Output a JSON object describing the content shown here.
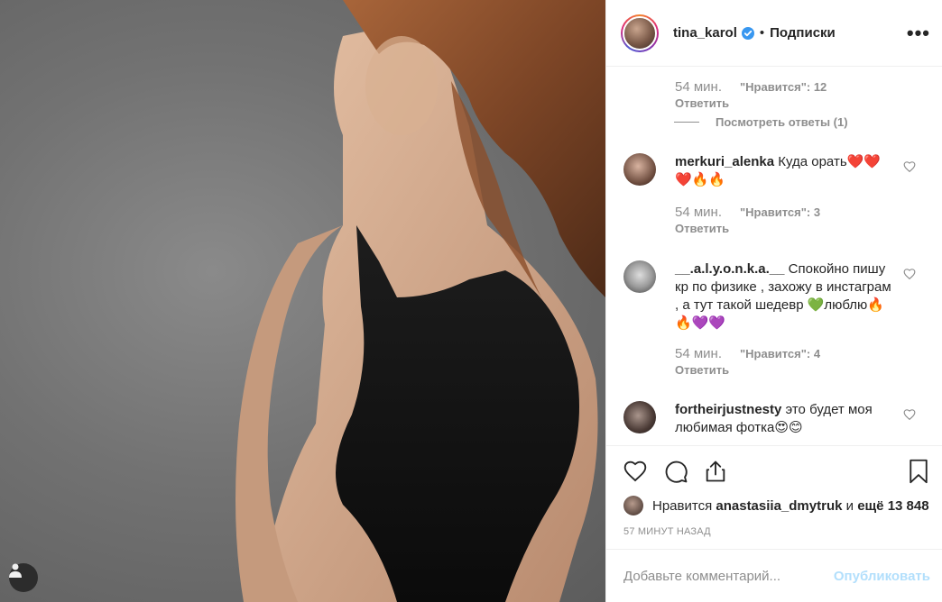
{
  "post": {
    "username": "tina_karol",
    "separator": "•",
    "follow_status": "Подписки",
    "more_label": "•••"
  },
  "top_comment_meta": {
    "time": "54 мин.",
    "likes": "\"Нравится\": 12",
    "reply": "Ответить"
  },
  "view_replies": "Посмотреть ответы (1)",
  "comments": [
    {
      "username": "merkuri_alenka",
      "text": "Куда орать❤️❤️❤️🔥🔥",
      "time": "54 мин.",
      "likes": "\"Нравится\": 3",
      "reply": "Ответить"
    },
    {
      "username": "__.a.l.y.o.n.k.a.__",
      "text": "Спокойно пишу кр по физике , захожу в инстаграм , а тут такой шедевр 💚люблю🔥🔥💜💜",
      "time": "54 мин.",
      "likes": "\"Нравится\": 4",
      "reply": "Ответить"
    },
    {
      "username": "fortheirjustnesty",
      "text": "это будет моя любимая фотка😍😊"
    }
  ],
  "likes": {
    "prefix": "Нравится",
    "user": "anastasiia_dmytruk",
    "connector": "и",
    "rest": "ещё 13 848"
  },
  "posted_ago": "57 МИНУТ НАЗАД",
  "add_comment": {
    "placeholder": "Добавьте комментарий...",
    "publish": "Опубликовать"
  },
  "colors": {
    "text": "#262626",
    "muted": "#8e8e8e",
    "verified": "#3897f0",
    "publish_disabled": "#b2dffc"
  },
  "icons": [
    "heart-icon",
    "comment-icon",
    "share-icon",
    "bookmark-icon",
    "verified-icon",
    "more-icon",
    "user-tag-icon"
  ]
}
